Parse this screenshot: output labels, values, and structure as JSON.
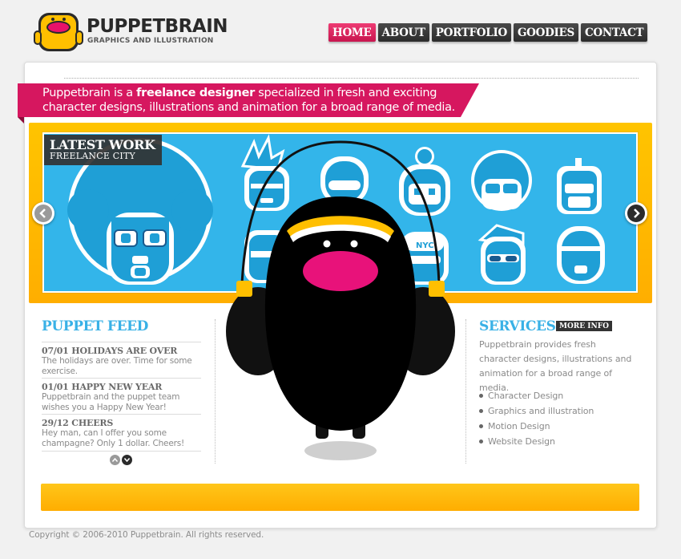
{
  "header": {
    "logo_title": "PUPPETBRAIN",
    "logo_subtitle": "GRAPHICS AND ILLUSTRATION",
    "logo_icon": "puppet-mascot-logo"
  },
  "nav": {
    "items": [
      {
        "label": "HOME",
        "active": true
      },
      {
        "label": "ABOUT",
        "active": false
      },
      {
        "label": "PORTFOLIO",
        "active": false
      },
      {
        "label": "GOODIES",
        "active": false
      },
      {
        "label": "CONTACT",
        "active": false
      }
    ]
  },
  "intro": {
    "text_before": "Puppetbrain is a ",
    "text_bold": "freelance designer",
    "text_after": " specialized in fresh and exciting character designs, illustrations and animation for a broad range of media."
  },
  "showcase": {
    "label_title": "LATEST WORK",
    "label_subtitle": "FREELANCE CITY",
    "prev_icon": "chevron-left-icon",
    "next_icon": "chevron-right-icon",
    "badge_text": "NYC"
  },
  "feed": {
    "title": "PUPPET FEED",
    "items": [
      {
        "heading": "07/01 HOLIDAYS ARE OVER",
        "body": "The holidays are over. Time for some exercise."
      },
      {
        "heading": "01/01 HAPPY NEW YEAR",
        "body": "Puppetbrain and the puppet team wishes you a Happy New Year!"
      },
      {
        "heading": "29/12 CHEERS",
        "body": "Hey man, can I offer you some champagne? Only 1 dollar. Cheers!"
      }
    ],
    "pager_up_icon": "chevron-up-icon",
    "pager_down_icon": "chevron-down-icon"
  },
  "services": {
    "title": "SERVICES",
    "more_info": "MORE INFO",
    "description": "Puppetbrain provides fresh character designs, illustrations and animation for a broad range of media.",
    "items": [
      "Character Design",
      "Graphics and illustration",
      "Motion Design",
      "Website Design"
    ]
  },
  "footer": {
    "copyright": "Copyright © 2006-2010 Puppetbrain. All rights reserved."
  },
  "colors": {
    "brand_pink": "#d6175f",
    "accent_blue": "#39b1e6",
    "banner_yellow": "#ffc400",
    "dark": "#2c2c2c"
  }
}
